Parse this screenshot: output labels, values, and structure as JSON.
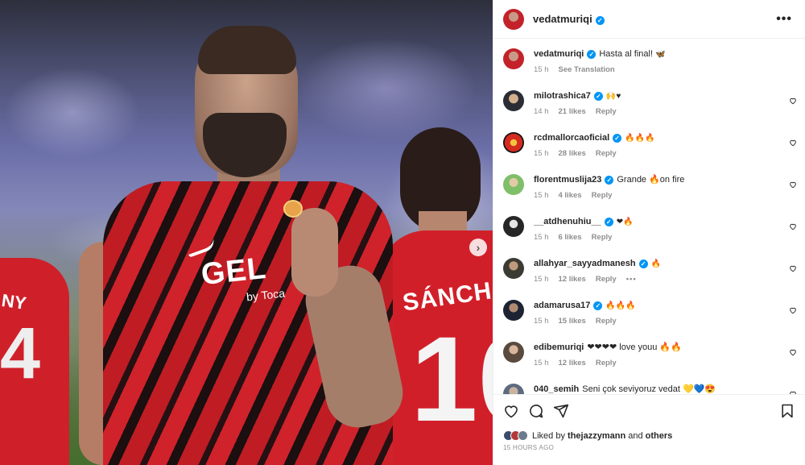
{
  "post": {
    "author": "vedatmuriqi",
    "more_icon": "more-dots-icon",
    "caption": "Hasta al final!",
    "caption_emoji": "🦋",
    "caption_time": "15 h",
    "see_translation": "See Translation",
    "timestamp": "15 HOURS AGO"
  },
  "comments": [
    {
      "user": "milotrashica7",
      "verified": true,
      "text": "🙌♥",
      "time": "14 h",
      "likes": "21 likes",
      "reply": "Reply"
    },
    {
      "user": "rcdmallorcaoficial",
      "verified": true,
      "text": "🔥🔥🔥",
      "time": "15 h",
      "likes": "28 likes",
      "reply": "Reply"
    },
    {
      "user": "florentmuslija23",
      "verified": true,
      "text": "Grande 🔥on fire",
      "time": "15 h",
      "likes": "4 likes",
      "reply": "Reply"
    },
    {
      "user": "__atdhenuhiu__",
      "verified": true,
      "text": "❤🔥",
      "time": "15 h",
      "likes": "6 likes",
      "reply": "Reply"
    },
    {
      "user": "allahyar_sayyadmanesh",
      "verified": true,
      "text": "🔥",
      "time": "15 h",
      "likes": "12 likes",
      "reply": "Reply",
      "more": "•••"
    },
    {
      "user": "adamarusa17",
      "verified": true,
      "text": "🔥🔥🔥",
      "time": "15 h",
      "likes": "15 likes",
      "reply": "Reply"
    },
    {
      "user": "edibemuriqi",
      "verified": false,
      "text": "❤❤❤❤ love youu 🔥🔥",
      "time": "15 h",
      "likes": "12 likes",
      "reply": "Reply"
    },
    {
      "user": "040_semih",
      "verified": false,
      "text": "Seni çok seviyoruz vedat 💛💙😍",
      "time": "",
      "likes": "",
      "reply": ""
    }
  ],
  "likes_line": {
    "prefix": "Liked by",
    "user": "thejazzymann",
    "joiner": "and",
    "others": "others"
  },
  "photo": {
    "sponsor": "GEL",
    "sponsor_sub": "by Toca",
    "back_name": "SÁNCH",
    "back_number": "10",
    "left_name": "NY",
    "left_number": "4",
    "next_icon": "chevron-right-icon"
  },
  "icons": {
    "like": "heart-icon",
    "comment": "comment-icon",
    "share": "paper-plane-icon",
    "save": "bookmark-icon"
  },
  "colors": {
    "verified": "#0095f6",
    "meta_text": "#8e8e8e",
    "kit_red": "#d0222a"
  }
}
